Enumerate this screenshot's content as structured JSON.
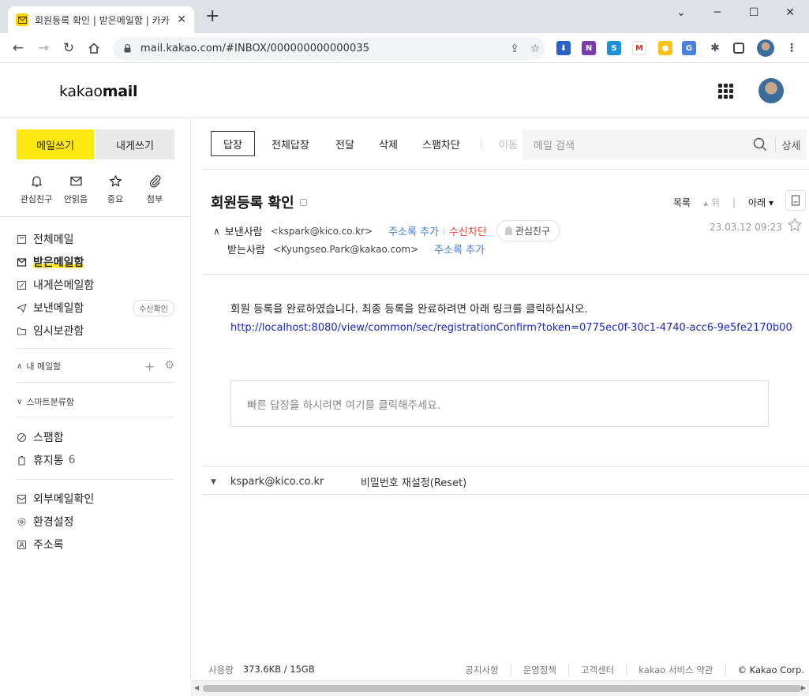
{
  "browser": {
    "tab_title": "회원등록 확인 | 받은메일함 | 카카",
    "url": "mail.kakao.com/#INBOX/000000000000035",
    "window_controls": {
      "minimize": "─",
      "maximize": "☐",
      "close": "✕"
    }
  },
  "header": {
    "logo_light": "kakao",
    "logo_bold": "mail"
  },
  "sidebar": {
    "compose_label": "메일쓰기",
    "self_label": "내게쓰기",
    "quick": [
      {
        "label": "관심친구",
        "icon": "bell-icon"
      },
      {
        "label": "안읽음",
        "icon": "envelope-icon"
      },
      {
        "label": "중요",
        "icon": "star-icon"
      },
      {
        "label": "첨부",
        "icon": "paperclip-icon"
      }
    ],
    "folders": [
      {
        "label": "전체메일",
        "icon": "all-mail-icon"
      },
      {
        "label": "받은메일함",
        "icon": "inbox-icon",
        "active": true
      },
      {
        "label": "내게쓴메일함",
        "icon": "memo-icon"
      },
      {
        "label": "보낸메일함",
        "icon": "send-icon",
        "badge": "수신확인"
      },
      {
        "label": "임시보관함",
        "icon": "folder-icon"
      }
    ],
    "my_mailbox_label": "내 메일함",
    "smart_label": "스마트분류함",
    "spam_label": "스팸함",
    "trash_label": "휴지통",
    "trash_count": "6",
    "tools": [
      {
        "label": "외부메일확인",
        "icon": "external-mail-icon"
      },
      {
        "label": "환경설정",
        "icon": "settings-gear-icon"
      },
      {
        "label": "주소록",
        "icon": "address-book-icon"
      }
    ]
  },
  "toolbar": {
    "reply": "답장",
    "reply_all": "전체답장",
    "forward": "전달",
    "delete": "삭제",
    "block_spam": "스팸차단",
    "move": "이동",
    "search_placeholder": "메일 검색",
    "search_detail": "상세"
  },
  "message": {
    "subject": "회원등록 확인",
    "list_label": "목록",
    "up_label": "위",
    "down_label": "아래",
    "from_label": "보낸사람",
    "from_addr": "<kspark@kico.co.kr>",
    "add_contact": "주소록 추가",
    "block_sender": "수신차단",
    "vip_label": "관심친구",
    "to_label": "받는사람",
    "to_addr": "<Kyungseo.Park@kakao.com>",
    "date": "23.03.12 09:23",
    "body_text": "회원 등록을 완료하였습니다. 최종 등록을 완료하려면 아래 링크를 클릭하십시오.",
    "body_link": "http://localhost:8080/view/common/sec/registrationConfirm?token=0775ec0f-30c1-4740-acc6-9e5fe2170b00",
    "quick_reply_placeholder": "빠른 답장을 하시려면 여기를 클릭해주세요."
  },
  "thread": {
    "from": "kspark@kico.co.kr",
    "subject": "비밀번호 재설정(Reset)"
  },
  "footer": {
    "usage_label": "사용량",
    "usage_value": "373.6KB / 15GB",
    "links": [
      "공지사항",
      "운영정책",
      "고객센터",
      "kakao 서비스 약관",
      "© Kakao Corp."
    ]
  }
}
